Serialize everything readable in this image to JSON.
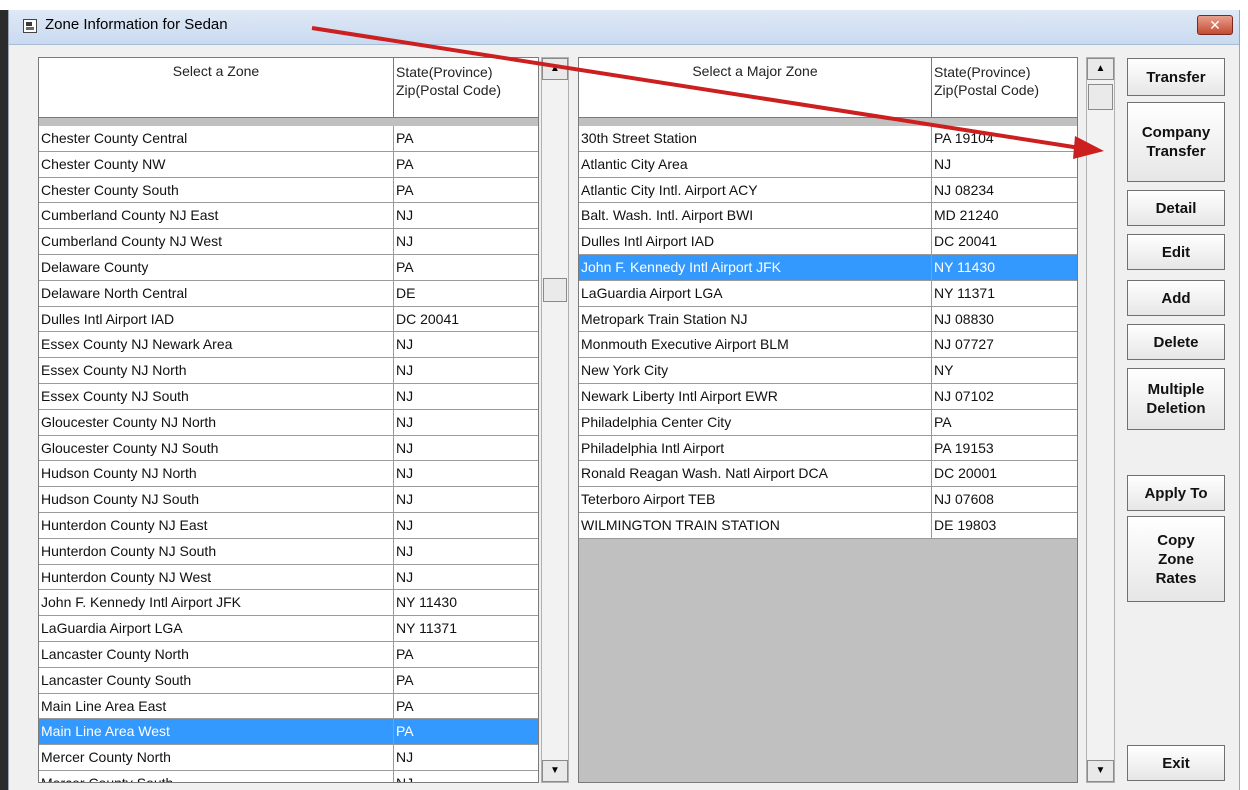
{
  "window": {
    "title": "Zone Information for Sedan",
    "close_label": "✕"
  },
  "left_grid": {
    "header_zone": "Select a Zone",
    "header_state": "State(Province) Zip(Postal Code)",
    "rows": [
      {
        "zone": "Chester County Central",
        "state": "PA"
      },
      {
        "zone": "Chester County NW",
        "state": "PA"
      },
      {
        "zone": "Chester County South",
        "state": "PA"
      },
      {
        "zone": "Cumberland County NJ East",
        "state": "NJ"
      },
      {
        "zone": "Cumberland County NJ West",
        "state": "NJ"
      },
      {
        "zone": "Delaware County",
        "state": "PA"
      },
      {
        "zone": "Delaware North Central",
        "state": "DE"
      },
      {
        "zone": "Dulles Intl Airport IAD",
        "state": "DC 20041"
      },
      {
        "zone": "Essex County NJ Newark Area",
        "state": "NJ"
      },
      {
        "zone": "Essex County NJ North",
        "state": "NJ"
      },
      {
        "zone": "Essex County NJ South",
        "state": "NJ"
      },
      {
        "zone": "Gloucester County NJ North",
        "state": "NJ"
      },
      {
        "zone": "Gloucester County NJ South",
        "state": "NJ"
      },
      {
        "zone": "Hudson County NJ North",
        "state": "NJ"
      },
      {
        "zone": "Hudson County NJ South",
        "state": "NJ"
      },
      {
        "zone": "Hunterdon County NJ East",
        "state": "NJ"
      },
      {
        "zone": "Hunterdon County NJ South",
        "state": "NJ"
      },
      {
        "zone": "Hunterdon County NJ West",
        "state": "NJ"
      },
      {
        "zone": "John F. Kennedy Intl Airport JFK",
        "state": "NY 11430"
      },
      {
        "zone": "LaGuardia Airport LGA",
        "state": "NY 11371"
      },
      {
        "zone": "Lancaster County North",
        "state": "PA"
      },
      {
        "zone": "Lancaster County South",
        "state": "PA"
      },
      {
        "zone": "Main Line Area East",
        "state": "PA"
      },
      {
        "zone": "Main Line Area West",
        "state": "PA",
        "selected": true
      },
      {
        "zone": "Mercer County North",
        "state": "NJ"
      },
      {
        "zone": "Mercer County South",
        "state": "NJ"
      }
    ]
  },
  "right_grid": {
    "header_zone": "Select a Major Zone",
    "header_state": "State(Province) Zip(Postal Code)",
    "rows": [
      {
        "zone": "30th Street Station",
        "state": "PA 19104"
      },
      {
        "zone": "Atlantic City Area",
        "state": "NJ"
      },
      {
        "zone": "Atlantic City Intl. Airport ACY",
        "state": "NJ 08234"
      },
      {
        "zone": "Balt. Wash. Intl. Airport BWI",
        "state": "MD 21240"
      },
      {
        "zone": "Dulles Intl Airport IAD",
        "state": "DC 20041"
      },
      {
        "zone": "John F. Kennedy Intl Airport JFK",
        "state": "NY 11430",
        "selected": true
      },
      {
        "zone": "LaGuardia Airport LGA",
        "state": "NY 11371"
      },
      {
        "zone": "Metropark Train Station NJ",
        "state": "NJ 08830"
      },
      {
        "zone": "Monmouth Executive Airport BLM",
        "state": "NJ 07727"
      },
      {
        "zone": "New York City",
        "state": "NY"
      },
      {
        "zone": "Newark Liberty Intl Airport EWR",
        "state": "NJ 07102"
      },
      {
        "zone": "Philadelphia Center City",
        "state": "PA"
      },
      {
        "zone": "Philadelphia Intl Airport",
        "state": "PA 19153"
      },
      {
        "zone": "Ronald Reagan Wash. Natl Airport DCA",
        "state": "DC 20001"
      },
      {
        "zone": "Teterboro Airport TEB",
        "state": "NJ 07608"
      },
      {
        "zone": "WILMINGTON TRAIN STATION",
        "state": "DE 19803"
      }
    ]
  },
  "buttons": {
    "transfer": "Transfer",
    "company_transfer": "Company Transfer",
    "detail": "Detail",
    "edit": "Edit",
    "add": "Add",
    "delete": "Delete",
    "multiple_deletion": "Multiple Deletion",
    "apply_to": "Apply To",
    "copy_zone_rates": "Copy Zone Rates",
    "exit": "Exit"
  },
  "colors": {
    "selection": "#3399ff",
    "annotation_arrow": "#cc1f1f"
  }
}
